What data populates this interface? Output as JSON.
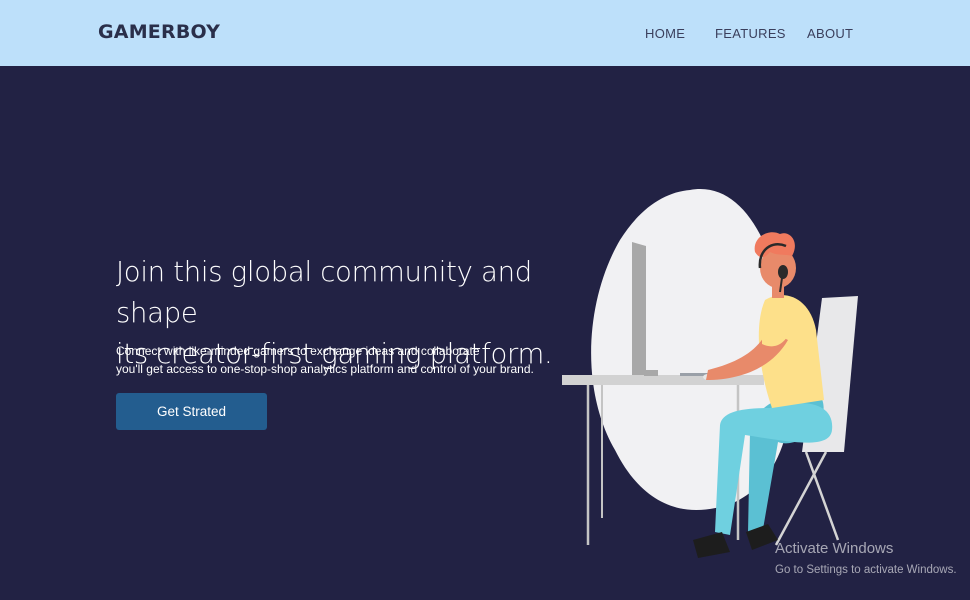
{
  "brand": {
    "name": "GAMERBOY"
  },
  "nav": {
    "items": [
      {
        "label": "HOME"
      },
      {
        "label": "FEATURES"
      },
      {
        "label": "ABOUT"
      }
    ]
  },
  "hero": {
    "headline_line1": "Join this global community and shape",
    "headline_line2": "its creator-first gaming platform.",
    "sub_line1": "Connect with like-minded gamers to exchange ideas and collaborate",
    "sub_line2": "you'll get access to one-stop-shop analytics platform and control of your brand.",
    "cta_label": "Get Strated"
  },
  "watermark": {
    "title": "Activate Windows",
    "subtitle": "Go to Settings to activate Windows."
  },
  "colors": {
    "page_background": "#222244",
    "navbar_background": "#bde0fa",
    "cta_background": "#235d8f",
    "blob": "#f1f1f3",
    "hair": "#f07a5e",
    "shirt": "#fde08a",
    "pants": "#6fd0e0"
  }
}
